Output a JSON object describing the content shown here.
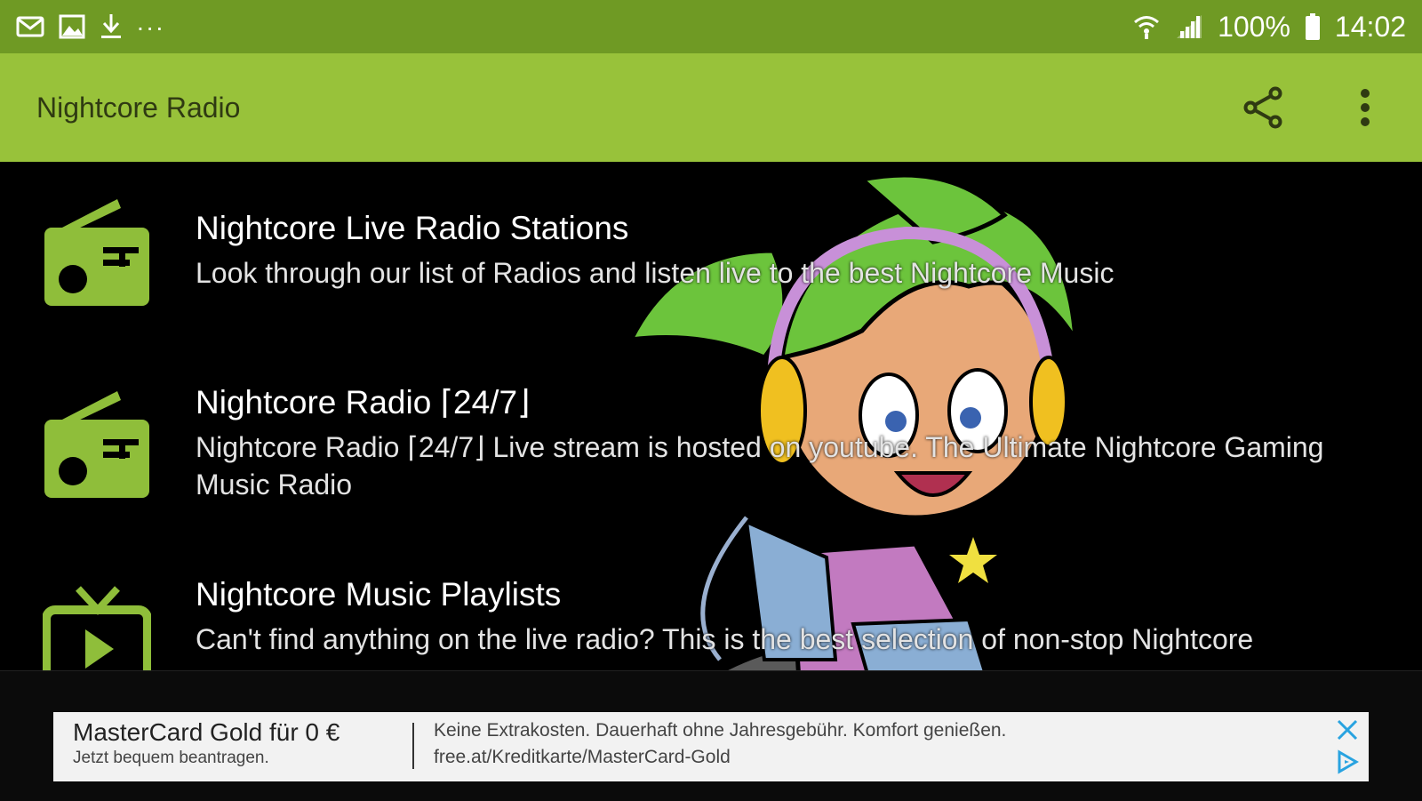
{
  "status_bar": {
    "left_icons": [
      "mail-icon",
      "image-icon",
      "download-icon"
    ],
    "overflow": "...",
    "battery": "100%",
    "time": "14:02",
    "right_icons": [
      "wifi-icon",
      "signal-icon",
      "battery-icon"
    ]
  },
  "app_bar": {
    "title": "Nightcore Radio",
    "actions": [
      "share-icon",
      "more-vert-icon"
    ]
  },
  "colors": {
    "status_bar": "#6f9a24",
    "app_bar": "#98c23a",
    "accent": "#8fbe3a",
    "background": "#000000"
  },
  "items": [
    {
      "icon": "radio-icon",
      "title": "Nightcore Live Radio Stations",
      "description": "Look through our list of Radios and listen live to the best Nightcore Music"
    },
    {
      "icon": "radio-icon",
      "title": "Nightcore Radio ⌈24/7⌋",
      "description": "Nightcore Radio ⌈24/7⌋ Live stream is hosted on youtube. The Ultimate Nightcore Gaming Music Radio"
    },
    {
      "icon": "tv-icon",
      "title": "Nightcore Music Playlists",
      "description": "Can't find anything on the live radio? This is the best selection of non-stop Nightcore"
    }
  ],
  "ad": {
    "headline": "MasterCard Gold für 0 €",
    "subline": "Jetzt bequem beantragen.",
    "body": "Keine Extrakosten. Dauerhaft ohne Jahresgebühr. Komfort genießen.",
    "url": "free.at/Kreditkarte/MasterCard-Gold"
  }
}
